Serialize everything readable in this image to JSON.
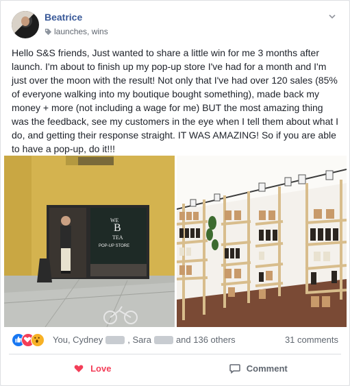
{
  "post": {
    "author": "Beatrice",
    "tags": "launches, wins",
    "text": "Hello S&S friends, Just wanted to share a little win for me 3 months after launch. I'm about to finish up my pop-up store I've had for a month and I'm just over the moon with the result! Not only that I've had over 120 sales (85% of everyone walking into my boutique bought something), made back my money + more (not including a wage for me) BUT the most amazing thing was the feedback, see my customers in the eye when I tell them about what I do, and getting their response straight. IT WAS AMAZING! So if you are able to have a pop-up, do it!!!"
  },
  "photos": {
    "left_sign_line1": "WE",
    "left_sign_line2": "B",
    "left_sign_line3": "TEA",
    "left_sign_line4": "POP-UP STORE"
  },
  "reactions": {
    "names_part1": "You, Cydney",
    "names_part2": ", Sara",
    "names_part3": "and 136 others",
    "comments": "31 comments"
  },
  "actions": {
    "love": "Love",
    "comment": "Comment"
  },
  "colors": {
    "link": "#385898",
    "love": "#f33e58",
    "like": "#1877f2",
    "wow": "#f7b125"
  }
}
